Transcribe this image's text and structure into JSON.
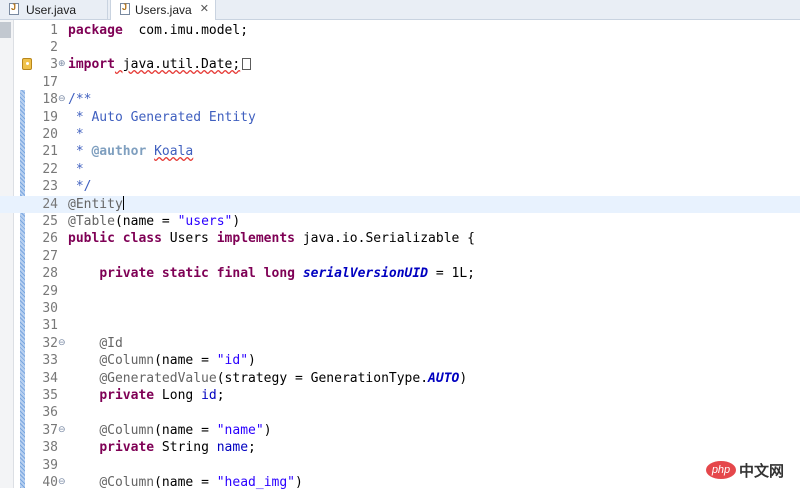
{
  "tabs": [
    {
      "label": "User.java",
      "active": false
    },
    {
      "label": "Users.java",
      "active": true,
      "close": "✕"
    }
  ],
  "colors": {
    "keyword": "#7f0055",
    "string": "#2a00ff",
    "comment": "#3f5fbf",
    "annotation": "#646464",
    "field": "#0000c0",
    "line_number": "#787878",
    "current_line_bg": "#e8f2fe"
  },
  "icons": {
    "file": "java-file-icon",
    "fold": "fold-toggle-icon",
    "warning": "import-warning-icon"
  },
  "editor": {
    "current_line": "24",
    "lines": [
      {
        "num": "1",
        "fold": "",
        "parts": [
          [
            "kw",
            "package"
          ],
          [
            "",
            "  com.imu.model;"
          ]
        ]
      },
      {
        "num": "2",
        "fold": "",
        "parts": []
      },
      {
        "num": "3",
        "fold": "⊕",
        "parts": [
          [
            "kw",
            "import"
          ],
          [
            "squig",
            " java.util.Date;"
          ],
          [
            "box",
            ""
          ]
        ]
      },
      {
        "num": "17",
        "fold": "",
        "parts": []
      },
      {
        "num": "18",
        "fold": "⊖",
        "parts": [
          [
            "cmt",
            "/**"
          ]
        ]
      },
      {
        "num": "19",
        "fold": "",
        "parts": [
          [
            "cmt",
            " * Auto Generated Entity"
          ]
        ]
      },
      {
        "num": "20",
        "fold": "",
        "parts": [
          [
            "cmt",
            " *"
          ]
        ]
      },
      {
        "num": "21",
        "fold": "",
        "parts": [
          [
            "cmt",
            " * "
          ],
          [
            "tag",
            "@author"
          ],
          [
            "cmt",
            " "
          ],
          [
            "cmt-squig",
            "Koala"
          ]
        ]
      },
      {
        "num": "22",
        "fold": "",
        "parts": [
          [
            "cmt",
            " *"
          ]
        ]
      },
      {
        "num": "23",
        "fold": "",
        "parts": [
          [
            "cmt",
            " */"
          ]
        ]
      },
      {
        "num": "24",
        "fold": "",
        "parts": [
          [
            "ann",
            "@Entity"
          ],
          [
            "caret",
            ""
          ]
        ]
      },
      {
        "num": "25",
        "fold": "",
        "parts": [
          [
            "ann",
            "@Table"
          ],
          [
            "",
            "(name = "
          ],
          [
            "str",
            "\"users\""
          ],
          [
            "",
            ")"
          ]
        ]
      },
      {
        "num": "26",
        "fold": "",
        "parts": [
          [
            "kw",
            "public class"
          ],
          [
            "",
            " Users "
          ],
          [
            "kw",
            "implements"
          ],
          [
            "",
            " java.io.Serializable {"
          ]
        ]
      },
      {
        "num": "27",
        "fold": "",
        "parts": []
      },
      {
        "num": "28",
        "fold": "",
        "parts": [
          [
            "",
            "    "
          ],
          [
            "kw",
            "private static final long"
          ],
          [
            "",
            " "
          ],
          [
            "fld-static",
            "serialVersionUID"
          ],
          [
            "",
            " = 1L;"
          ]
        ]
      },
      {
        "num": "29",
        "fold": "",
        "parts": []
      },
      {
        "num": "30",
        "fold": "",
        "parts": []
      },
      {
        "num": "31",
        "fold": "",
        "parts": []
      },
      {
        "num": "32",
        "fold": "⊖",
        "parts": [
          [
            "",
            "    "
          ],
          [
            "ann",
            "@Id"
          ]
        ]
      },
      {
        "num": "33",
        "fold": "",
        "parts": [
          [
            "",
            "    "
          ],
          [
            "ann",
            "@Column"
          ],
          [
            "",
            "(name = "
          ],
          [
            "str",
            "\"id\""
          ],
          [
            "",
            ")"
          ]
        ]
      },
      {
        "num": "34",
        "fold": "",
        "parts": [
          [
            "",
            "    "
          ],
          [
            "ann",
            "@GeneratedValue"
          ],
          [
            "",
            "(strategy = GenerationType."
          ],
          [
            "enum-c",
            "AUTO"
          ],
          [
            "",
            ")"
          ]
        ]
      },
      {
        "num": "35",
        "fold": "",
        "parts": [
          [
            "",
            "    "
          ],
          [
            "kw",
            "private"
          ],
          [
            "",
            " Long "
          ],
          [
            "fld",
            "id"
          ],
          [
            "",
            ";"
          ]
        ]
      },
      {
        "num": "36",
        "fold": "",
        "parts": []
      },
      {
        "num": "37",
        "fold": "⊖",
        "parts": [
          [
            "",
            "    "
          ],
          [
            "ann",
            "@Column"
          ],
          [
            "",
            "(name = "
          ],
          [
            "str",
            "\"name\""
          ],
          [
            "",
            ")"
          ]
        ]
      },
      {
        "num": "38",
        "fold": "",
        "parts": [
          [
            "",
            "    "
          ],
          [
            "kw",
            "private"
          ],
          [
            "",
            " String "
          ],
          [
            "fld",
            "name"
          ],
          [
            "",
            ";"
          ]
        ]
      },
      {
        "num": "39",
        "fold": "",
        "parts": []
      },
      {
        "num": "40",
        "fold": "⊖",
        "parts": [
          [
            "",
            "    "
          ],
          [
            "ann",
            "@Column"
          ],
          [
            "",
            "(name = "
          ],
          [
            "str",
            "\"head_img\""
          ],
          [
            "",
            ")"
          ]
        ]
      }
    ]
  },
  "watermark": {
    "logo_text": "php",
    "site_text": "中文网"
  }
}
